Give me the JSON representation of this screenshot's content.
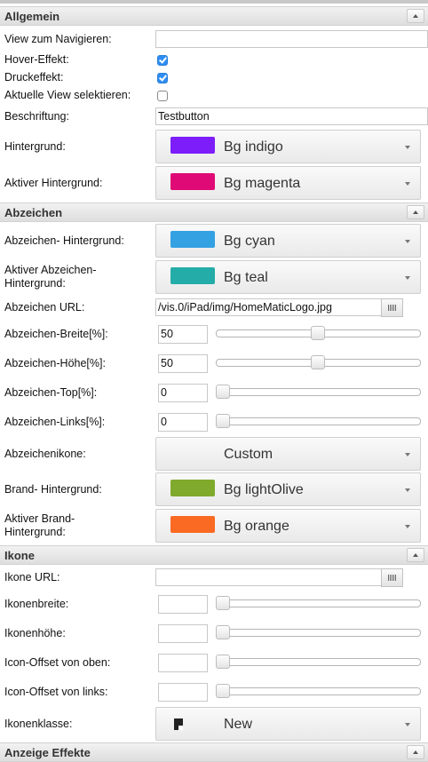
{
  "sections": {
    "allgemein": "Allgemein",
    "abzeichen": "Abzeichen",
    "ikone": "Ikone",
    "anzeige": "Anzeige Effekte"
  },
  "allgemein": {
    "view_label": "View zum Navigieren:",
    "view_value": "",
    "hover_label": "Hover-Effekt:",
    "hover_checked": true,
    "druck_label": "Druckeffekt:",
    "druck_checked": true,
    "aktuelle_label": "Aktuelle View selektieren:",
    "aktuelle_checked": false,
    "beschriftung_label": "Beschriftung:",
    "beschriftung_value": "Testbutton",
    "hintergrund_label": "Hintergrund:",
    "hintergrund_value": "Bg indigo",
    "hintergrund_color": "#7c1dfa",
    "aktiv_hintergrund_label": "Aktiver Hintergrund:",
    "aktiv_hintergrund_value": "Bg magenta",
    "aktiv_hintergrund_color": "#df0a75"
  },
  "abzeichen": {
    "hintergrund_label": "Abzeichen- Hintergrund:",
    "hintergrund_value": "Bg cyan",
    "hintergrund_color": "#34a1e2",
    "aktiv_label_1": "Aktiver Abzeichen-",
    "aktiv_label_2": "Hintergrund:",
    "aktiv_value": "Bg teal",
    "aktiv_color": "#24aca9",
    "url_label": "Abzeichen URL:",
    "url_value": "/vis.0/iPad/img/HomeMaticLogo.jpg",
    "breite_label": "Abzeichen-Breite[%]:",
    "breite_value": "50",
    "hoehe_label": "Abzeichen-Höhe[%]:",
    "hoehe_value": "50",
    "top_label": "Abzeichen-Top[%]:",
    "top_value": "0",
    "links_label": "Abzeichen-Links[%]:",
    "links_value": "0",
    "ikone_label": "Abzeichenikone:",
    "ikone_value": "Custom",
    "brand_label": "Brand- Hintergrund:",
    "brand_value": "Bg lightOlive",
    "brand_color": "#7faa2c",
    "aktiv_brand_label_1": "Aktiver Brand-",
    "aktiv_brand_label_2": "Hintergrund:",
    "aktiv_brand_value": "Bg orange",
    "aktiv_brand_color": "#fa6a22"
  },
  "ikone": {
    "url_label": "Ikone URL:",
    "url_value": "",
    "breite_label": "Ikonenbreite:",
    "breite_value": "",
    "hoehe_label": "Ikonenhöhe:",
    "hoehe_value": "",
    "offset_oben_label": "Icon-Offset von oben:",
    "offset_oben_value": "",
    "offset_links_label": "Icon-Offset von links:",
    "offset_links_value": "",
    "klasse_label": "Ikonenklasse:",
    "klasse_value": "New",
    "klasse_icon": "new-class-icon"
  },
  "sliders": {
    "abzeichen_breite": 0.5,
    "abzeichen_hoehe": 0.5,
    "abzeichen_top": 0,
    "abzeichen_links": 0,
    "ikonenbreite": 0,
    "ikonenhoehe": 0,
    "offset_oben": 0,
    "offset_links": 0
  }
}
